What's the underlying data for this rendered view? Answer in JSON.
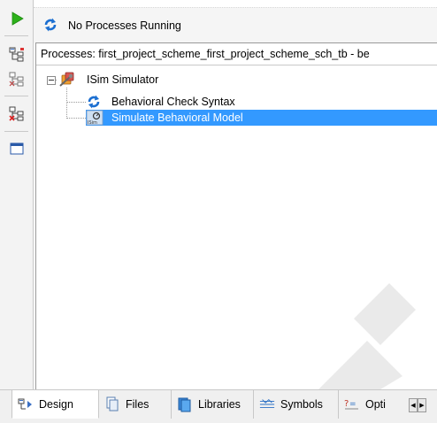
{
  "status": {
    "text": "No Processes Running",
    "icon": "refresh-icon"
  },
  "processes": {
    "header": "Processes: first_project_scheme_first_project_scheme_sch_tb - be",
    "tree": [
      {
        "label": "ISim Simulator",
        "icon": "isim-tools-icon",
        "level": 0,
        "expanded": true,
        "selected": false
      },
      {
        "label": "Behavioral Check Syntax",
        "icon": "refresh-icon",
        "level": 1,
        "selected": false
      },
      {
        "label": "Simulate Behavioral Model",
        "icon": "isim-simulate-icon",
        "level": 1,
        "selected": true
      }
    ]
  },
  "toolbar": {
    "buttons": [
      {
        "name": "run-button",
        "icon": "green-play-icon"
      },
      {
        "name": "hierarchy-button-1",
        "icon": "hierarchy-icon"
      },
      {
        "name": "hierarchy-button-2",
        "icon": "hierarchy-icon"
      },
      {
        "name": "hierarchy-button-3",
        "icon": "hierarchy-icon"
      },
      {
        "name": "panel-button",
        "icon": "window-icon"
      }
    ]
  },
  "tabs": [
    {
      "label": "Design",
      "icon": "design-icon",
      "active": true
    },
    {
      "label": "Files",
      "icon": "files-icon",
      "active": false
    },
    {
      "label": "Libraries",
      "icon": "libraries-icon",
      "active": false
    },
    {
      "label": "Symbols",
      "icon": "symbols-icon",
      "active": false
    },
    {
      "label": "Opti",
      "icon": "options-icon",
      "active": false
    }
  ],
  "colors": {
    "selection": "#3399ff",
    "accent_green": "#2cb11a",
    "refresh_blue": "#1c6fd1"
  }
}
